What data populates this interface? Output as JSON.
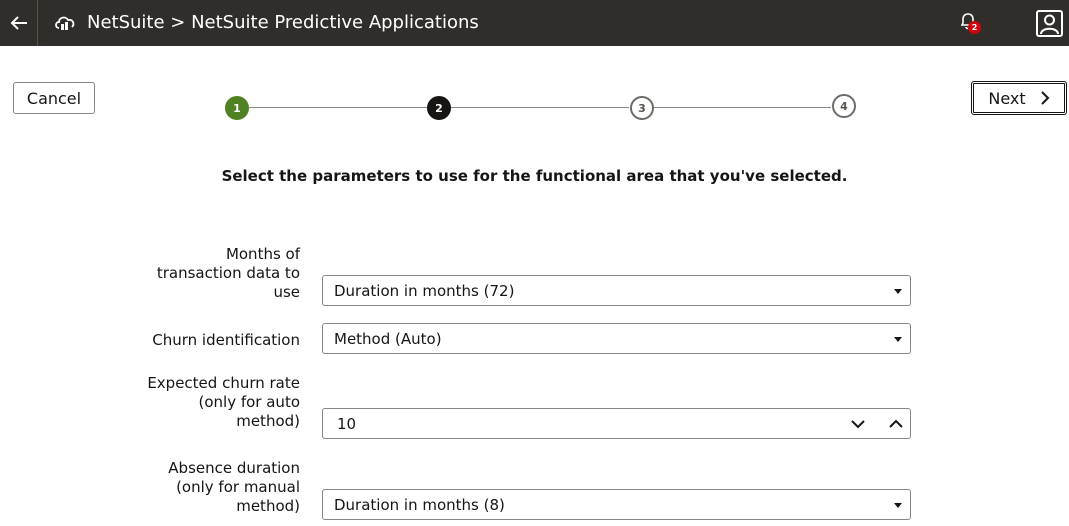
{
  "header": {
    "title": "NetSuite > NetSuite Predictive Applications",
    "back_icon": "back-arrow-icon",
    "logo_icon": "cloud-icon",
    "notification_count": "2",
    "bg_color": "#312d2a"
  },
  "toolbar": {
    "cancel_label": "Cancel",
    "next_label": "Next"
  },
  "train": {
    "steps": [
      {
        "label": "1",
        "state": "completed",
        "color": "#508223"
      },
      {
        "label": "2",
        "state": "current",
        "color": "#161513"
      },
      {
        "label": "3",
        "state": "not-visited"
      },
      {
        "label": "4",
        "state": "not-visited"
      }
    ]
  },
  "instruction": "Select the parameters to use for the functional area that you've selected.",
  "form": {
    "months": {
      "label": "Months of transaction data to use",
      "value": "Duration in months (72)"
    },
    "churn_id": {
      "label": "Churn identification",
      "value": "Method (Auto)"
    },
    "churn_rate": {
      "label": "Expected churn rate (only for auto method)",
      "value": "10"
    },
    "absence": {
      "label": "Absence duration (only for manual method)",
      "value": "Duration in months (8)"
    }
  }
}
